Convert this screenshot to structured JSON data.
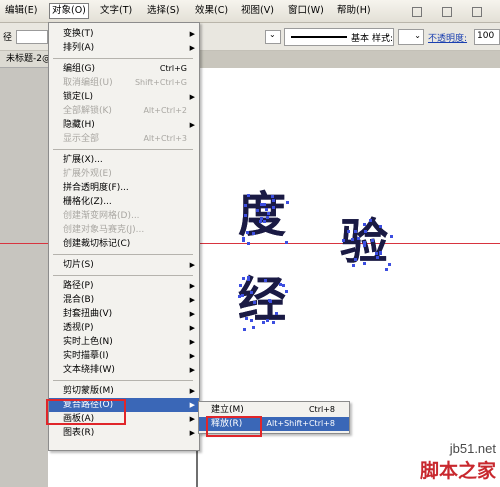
{
  "menubar": {
    "items": [
      "编辑(E)",
      "对象(O)",
      "文字(T)",
      "选择(S)",
      "效果(C)",
      "视图(V)",
      "窗口(W)",
      "帮助(H)"
    ]
  },
  "control_bar": {
    "left_label": "径",
    "stroke_style": "基本",
    "style_label": "样式:",
    "opacity_label": "不透明度:",
    "opacity_value": "100"
  },
  "document_tab": "未标题-2@",
  "object_menu": [
    {
      "label": "变换(T)",
      "submenu": true
    },
    {
      "label": "排列(A)",
      "submenu": true
    },
    {
      "sep": true
    },
    {
      "label": "编组(G)",
      "shortcut": "Ctrl+G"
    },
    {
      "label": "取消编组(U)",
      "shortcut": "Shift+Ctrl+G",
      "disabled": true
    },
    {
      "label": "锁定(L)",
      "submenu": true
    },
    {
      "label": "全部解锁(K)",
      "shortcut": "Alt+Ctrl+2",
      "disabled": true
    },
    {
      "label": "隐藏(H)",
      "submenu": true
    },
    {
      "label": "显示全部",
      "shortcut": "Alt+Ctrl+3",
      "disabled": true
    },
    {
      "sep": true
    },
    {
      "label": "扩展(X)..."
    },
    {
      "label": "扩展外观(E)",
      "disabled": true
    },
    {
      "label": "拼合透明度(F)..."
    },
    {
      "label": "栅格化(Z)..."
    },
    {
      "label": "创建渐变网格(D)...",
      "disabled": true
    },
    {
      "label": "创建对象马赛克(J)...",
      "disabled": true
    },
    {
      "label": "创建裁切标记(C)"
    },
    {
      "sep": true
    },
    {
      "label": "切片(S)",
      "submenu": true
    },
    {
      "sep": true
    },
    {
      "label": "路径(P)",
      "submenu": true
    },
    {
      "label": "混合(B)",
      "submenu": true
    },
    {
      "label": "封套扭曲(V)",
      "submenu": true
    },
    {
      "label": "透视(P)",
      "submenu": true
    },
    {
      "label": "实时上色(N)",
      "submenu": true
    },
    {
      "label": "实时描摹(I)",
      "submenu": true
    },
    {
      "label": "文本绕排(W)",
      "submenu": true
    },
    {
      "sep": true
    },
    {
      "label": "剪切蒙版(M)",
      "submenu": true
    },
    {
      "label": "复合路径(O)",
      "submenu": true,
      "selected": true
    },
    {
      "label": "画板(A)",
      "submenu": true
    },
    {
      "label": "图表(R)",
      "submenu": true
    }
  ],
  "compound_path_submenu": [
    {
      "label": "建立(M)",
      "shortcut": "Ctrl+8"
    },
    {
      "label": "释放(R)",
      "shortcut": "Alt+Shift+Ctrl+8",
      "selected": true
    }
  ],
  "canvas_text": [
    "度",
    "验",
    "经"
  ],
  "watermark": {
    "site": "jb51.net",
    "name": "脚本之家"
  },
  "colors": {
    "menu_highlight": "#3a67b7",
    "guide": "#d8343f",
    "annotation_box": "#e0262a",
    "glyph": "#1a1a44"
  }
}
